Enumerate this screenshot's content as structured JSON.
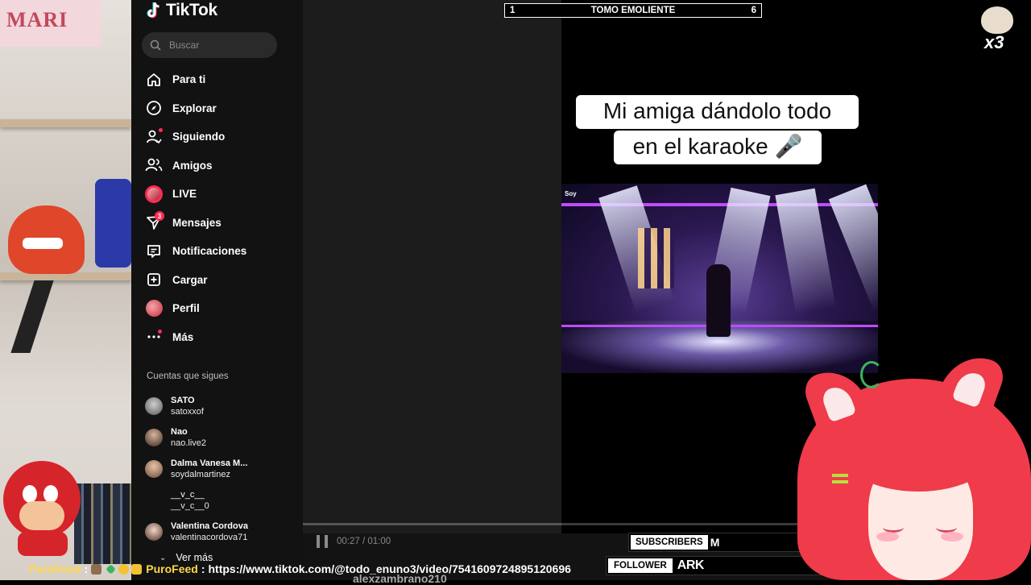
{
  "app": {
    "name": "TikTok"
  },
  "search": {
    "placeholder": "Buscar"
  },
  "nav": {
    "items": [
      {
        "label": "Para ti",
        "icon": "home-icon"
      },
      {
        "label": "Explorar",
        "icon": "compass-icon"
      },
      {
        "label": "Siguiendo",
        "icon": "following-icon"
      },
      {
        "label": "Amigos",
        "icon": "friends-icon"
      },
      {
        "label": "LIVE",
        "icon": "live-avatar-icon"
      },
      {
        "label": "Mensajes",
        "icon": "messages-icon",
        "badge": "3"
      },
      {
        "label": "Notificaciones",
        "icon": "notifications-icon"
      },
      {
        "label": "Cargar",
        "icon": "upload-icon"
      },
      {
        "label": "Perfil",
        "icon": "profile-avatar-icon"
      },
      {
        "label": "Más",
        "icon": "more-icon"
      }
    ]
  },
  "following": {
    "title": "Cuentas que sigues",
    "accounts": [
      {
        "name": "SATO",
        "username": "satoxxof"
      },
      {
        "name": "Nao",
        "username": "nao.live2"
      },
      {
        "name": "Dalma Vanesa M...",
        "username": "soydalmartinez"
      },
      {
        "name": "__v_c__",
        "username": "__v_c__0"
      },
      {
        "name": "Valentina Cordova",
        "username": "valentinacordova71"
      }
    ],
    "more_label": "Ver más"
  },
  "video": {
    "caption_line1": "Mi amiga dándolo todo",
    "caption_line2": "en el karaoke 🎤",
    "channel_tag": "Soy",
    "elapsed": "00:27",
    "duration": "01:00",
    "time_display": "00:27 / 01:00",
    "progress_fraction": 0.45
  },
  "counter": {
    "left": "1",
    "title": "TOMO EMOLIENTE",
    "right": "6"
  },
  "overlays": {
    "subscribers_label": "SUBSCRIBERS",
    "subscribers_value": "M",
    "follower_label": "FOLLOWER",
    "follower_value": "ARK",
    "cat_multiplier": "x3"
  },
  "chat": {
    "user1": "PuroFeed",
    "user2": "PuroFeed",
    "message": "https://www.tiktok.com/@todo_enuno3/video/7541609724895120696",
    "ghost_text": "alexzambrano210"
  },
  "background": {
    "poster_text": "MARI"
  },
  "colors": {
    "accent": "#fe2c55",
    "sidebar_bg": "#121212",
    "chat_name": "#ffd84a"
  }
}
